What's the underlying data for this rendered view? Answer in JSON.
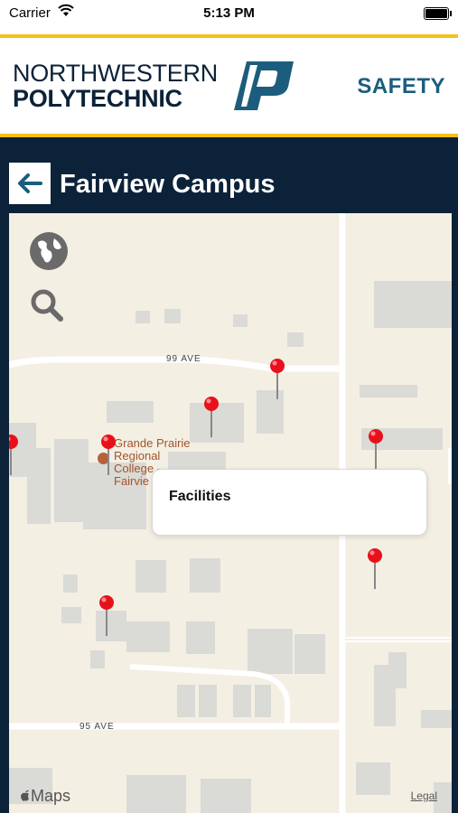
{
  "status": {
    "carrier": "Carrier",
    "time": "5:13 PM"
  },
  "header": {
    "logo_line1": "NORTHWESTERN",
    "logo_line2": "POLYTECHNIC",
    "section": "SAFETY"
  },
  "titlebar": {
    "title": "Fairview Campus"
  },
  "map": {
    "streets": {
      "top": "99 AVE",
      "bottom": "95 AVE"
    },
    "poi": {
      "line1": "Grande Prairie",
      "line2": "Regional",
      "line3": "College -",
      "line4": "Fairvie"
    },
    "popup": {
      "label": "Facilities"
    },
    "attribution": "Maps",
    "legal": "Legal"
  },
  "colors": {
    "navy": "#0c2239",
    "gold": "#f2c21b",
    "safety": "#1c5d7d",
    "pin": "#e8111b"
  }
}
